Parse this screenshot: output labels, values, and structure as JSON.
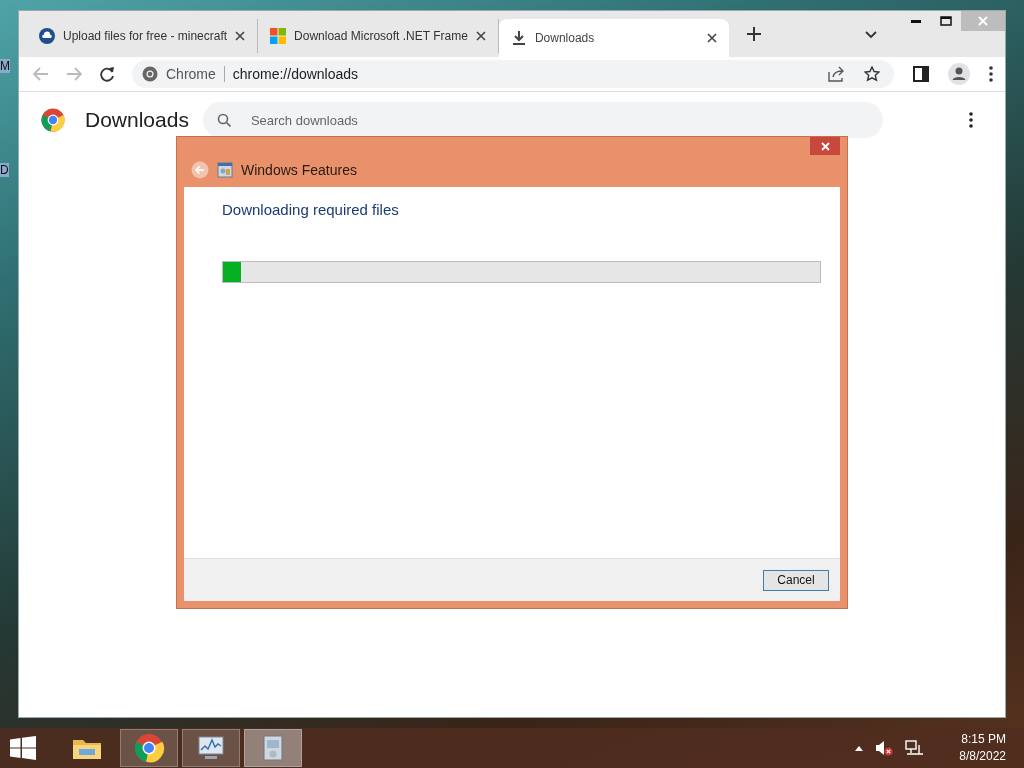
{
  "desktop": {
    "icon_labels": [
      "M",
      "D"
    ]
  },
  "browser": {
    "tabs": [
      {
        "kind": "cloud",
        "title": "Upload files for free - minecraft",
        "selected": false
      },
      {
        "kind": "windows",
        "title": "Download Microsoft .NET Frame",
        "selected": false
      },
      {
        "kind": "download",
        "title": "Downloads",
        "selected": true
      }
    ],
    "omnibox": {
      "site_label": "Chrome",
      "url": "chrome://downloads"
    },
    "page": {
      "heading": "Downloads",
      "search": {
        "placeholder": "Search downloads"
      }
    }
  },
  "dialog": {
    "title": "Windows Features",
    "heading": "Downloading required files",
    "progress": {
      "level": 0.03
    },
    "buttons": [
      "Cancel"
    ]
  },
  "taskbar": {
    "apps": [
      {
        "kind": "folder",
        "running": false,
        "selected": false
      },
      {
        "kind": "chrome",
        "running": true,
        "selected": false
      },
      {
        "kind": "monitor",
        "running": true,
        "selected": false
      },
      {
        "kind": "installer",
        "running": true,
        "selected": true
      }
    ],
    "clock": {
      "time": "8:15 PM",
      "date": "8/8/2022"
    }
  }
}
